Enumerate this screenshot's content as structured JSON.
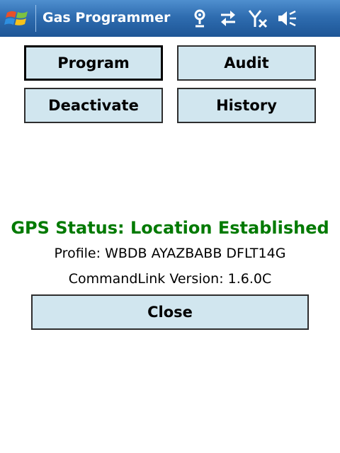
{
  "app": {
    "title": "Gas Programmer"
  },
  "tray": {
    "icons": [
      "gps-icon",
      "connectivity-icon",
      "no-signal-icon",
      "volume-muted-icon"
    ]
  },
  "buttons": {
    "program": "Program",
    "audit": "Audit",
    "deactivate": "Deactivate",
    "history": "History",
    "close": "Close"
  },
  "status": {
    "gps": "GPS Status: Location Established",
    "profile": "Profile: WBDB AYAZBABB DFLT14G",
    "version": "CommandLink Version: 1.6.0C"
  },
  "colors": {
    "titlebar": "#2f6db0",
    "button_fill": "#d1e6ef",
    "gps_status": "#007a00"
  }
}
